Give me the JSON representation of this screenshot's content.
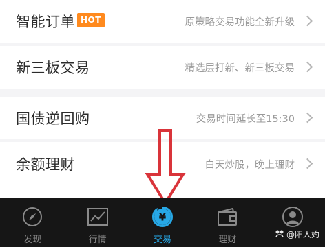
{
  "list": {
    "items": [
      {
        "title": "智能订单",
        "badge": "HOT",
        "desc": "原策略交易功能全新升级"
      },
      {
        "title": "新三板交易",
        "desc": "精选层打新、新三板交易"
      },
      {
        "title": "国债逆回购",
        "desc": "交易时间延长至15:30"
      },
      {
        "title": "余额理财",
        "desc": "白天炒股，晚上理财"
      }
    ]
  },
  "tabbar": {
    "tabs": [
      {
        "label": "发现",
        "icon": "compass-icon"
      },
      {
        "label": "行情",
        "icon": "chart-trend-icon"
      },
      {
        "label": "交易",
        "icon": "yen-icon",
        "active": true
      },
      {
        "label": "理财",
        "icon": "wallet-icon"
      },
      {
        "label": "",
        "icon": "profile-icon"
      }
    ]
  },
  "watermark": {
    "text": "@阳人妁"
  },
  "colors": {
    "accent": "#27a8e6",
    "hot_badge": "#ff8a1e",
    "arrow": "#d9343a",
    "tabbar_bg": "#161616"
  }
}
